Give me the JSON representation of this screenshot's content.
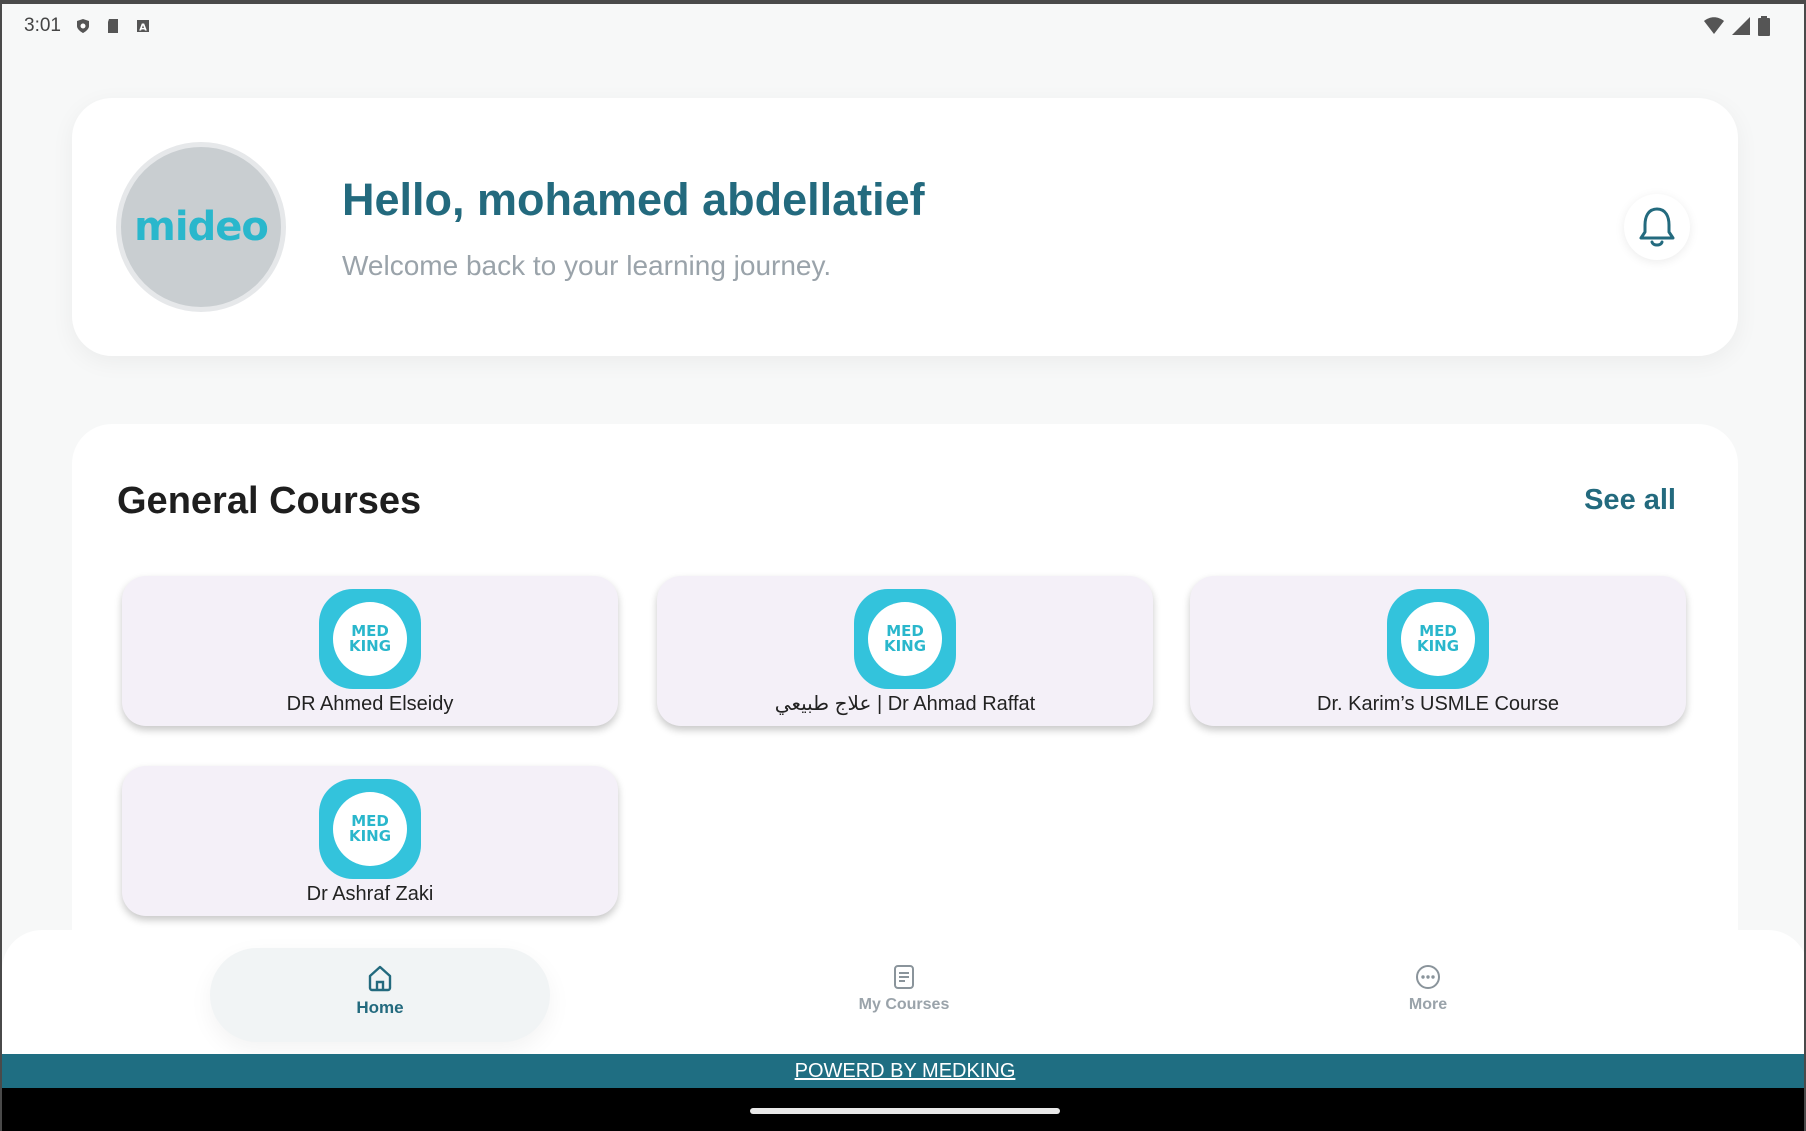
{
  "status_bar": {
    "time": "3:01"
  },
  "header": {
    "avatar_logo": "mideo",
    "greeting": "Hello, mohamed abdellatief",
    "welcome": "Welcome back to your learning journey."
  },
  "courses": {
    "title": "General Courses",
    "see_all": "See all",
    "logo_text": "MED KING",
    "items": [
      {
        "name": "DR Ahmed Elseidy"
      },
      {
        "name": "علاج طبيعي | Dr Ahmad Raffat"
      },
      {
        "name": "Dr. Karim’s USMLE Course"
      },
      {
        "name": "Dr Ashraf Zaki"
      }
    ]
  },
  "nav": {
    "home": "Home",
    "my_courses": "My Courses",
    "more": "More"
  },
  "footer": {
    "text": "POWERD BY MEDKING"
  },
  "colors": {
    "primary": "#236a7e",
    "accent": "#33c3dc",
    "card_bg": "#f4f0f8",
    "footer_bg": "#1f6e82"
  }
}
